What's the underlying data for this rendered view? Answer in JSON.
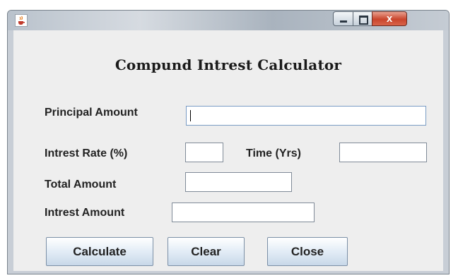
{
  "window": {
    "icon": "java-cup-icon",
    "controls": {
      "minimize": "minimize-icon",
      "maximize": "maximize-icon",
      "close_label": "x"
    }
  },
  "form": {
    "title": "Compund Intrest Calculator",
    "principal_label": "Principal Amount",
    "principal_value": "",
    "rate_label": "Intrest Rate (%)",
    "rate_value": "",
    "time_label": "Time (Yrs)",
    "time_value": "",
    "total_label": "Total Amount",
    "total_value": "",
    "interest_label": "Intrest Amount",
    "interest_value": ""
  },
  "buttons": {
    "calculate": "Calculate",
    "clear": "Clear",
    "close": "Close"
  }
}
